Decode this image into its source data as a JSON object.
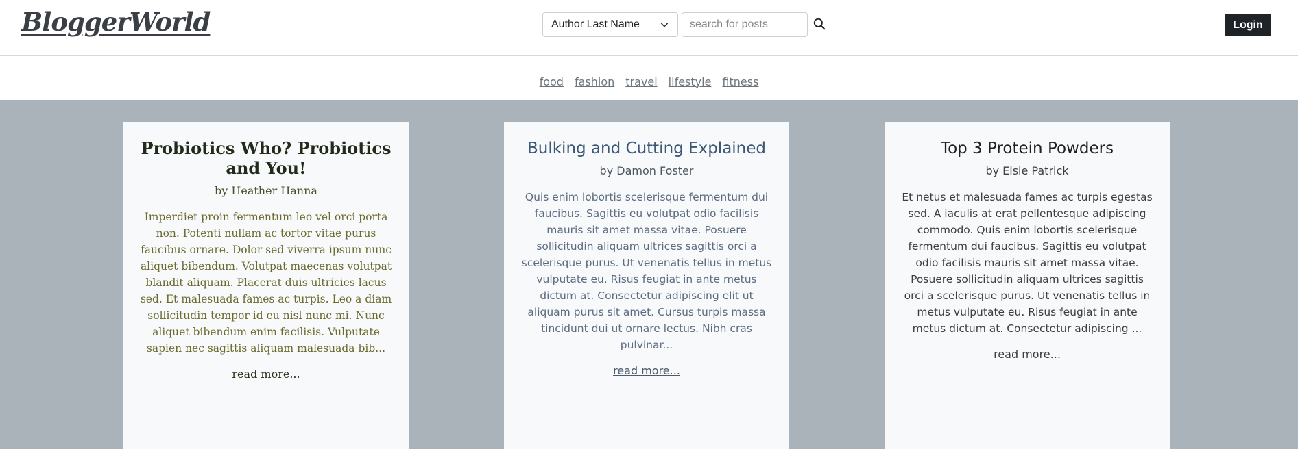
{
  "header": {
    "logo": "BloggerWorld",
    "search_filter": "Author Last Name",
    "search_placeholder": "search for posts",
    "login_label": "Login"
  },
  "categories": [
    "food",
    "fashion",
    "travel",
    "lifestyle",
    "fitness"
  ],
  "posts": [
    {
      "title": "Probiotics Who? Probiotics and You!",
      "author": "by Heather Hanna",
      "excerpt": "Imperdiet proin fermentum leo vel orci porta non. Potenti nullam ac tortor vitae purus faucibus ornare. Dolor sed viverra ipsum nunc aliquet bibendum. Volutpat maecenas volutpat blandit aliquam. Placerat duis ultricies lacus sed. Et malesuada fames ac turpis. Leo a diam sollicitudin tempor id eu nisl nunc mi. Nunc aliquet bibendum enim facilisis. Vulputate sapien nec sagittis aliquam malesuada bib...",
      "read_more": "read more..."
    },
    {
      "title": "Bulking and Cutting Explained",
      "author": "by Damon Foster",
      "excerpt": "Quis enim lobortis scelerisque fermentum dui faucibus. Sagittis eu volutpat odio facilisis mauris sit amet massa vitae. Posuere sollicitudin aliquam ultrices sagittis orci a scelerisque purus. Ut venenatis tellus in metus vulputate eu. Risus feugiat in ante metus dictum at. Consectetur adipiscing elit ut aliquam purus sit amet. Cursus turpis massa tincidunt dui ut ornare lectus. Nibh cras pulvinar...",
      "read_more": "read more..."
    },
    {
      "title": "Top 3 Protein Powders",
      "author": "by Elsie Patrick",
      "excerpt": "Et netus et malesuada fames ac turpis egestas sed. A iaculis at erat pellentesque adipiscing commodo. Quis enim lobortis scelerisque fermentum dui faucibus. Sagittis eu volutpat odio facilisis mauris sit amet massa vitae. Posuere sollicitudin aliquam ultrices sagittis orci a scelerisque purus. Ut venenatis tellus in metus vulputate eu. Risus feugiat in ante metus dictum at. Consectetur adipiscing ...",
      "read_more": "read more..."
    }
  ],
  "colors": {
    "page_background": "#aab2ba",
    "card_background": "#f7f9fa",
    "login_button": "#1f2328"
  },
  "icons": {
    "dropdown": "chevron-down-icon",
    "search": "search-icon"
  }
}
